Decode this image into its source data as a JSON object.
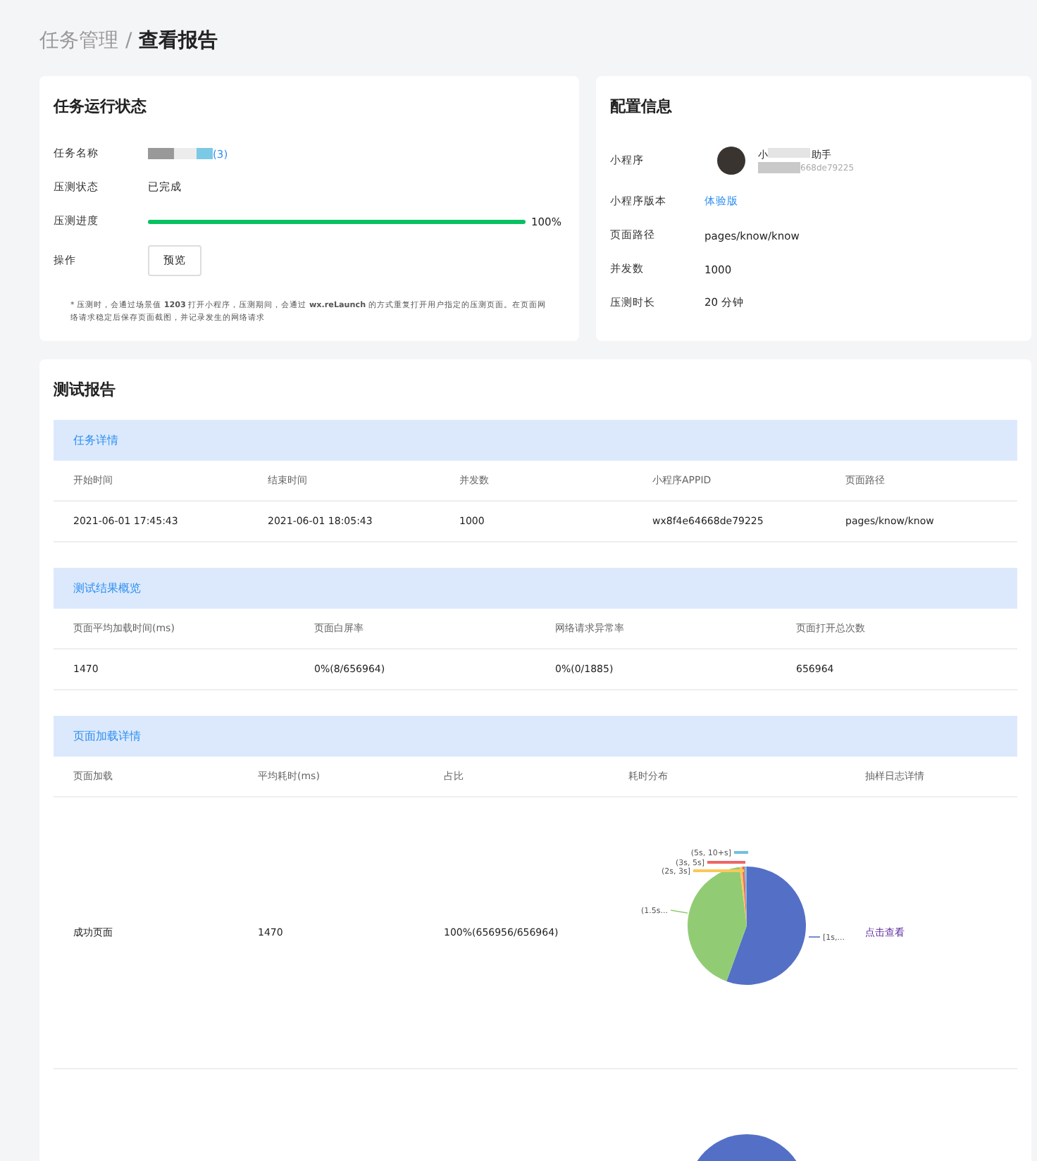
{
  "breadcrumb": {
    "parent": "任务管理",
    "separator": "/",
    "current": "查看报告"
  },
  "status_card": {
    "title": "任务运行状态",
    "rows": [
      {
        "kind": "redacted",
        "label": "任务名称",
        "value": "(3)"
      },
      {
        "kind": "text",
        "label": "压测状态",
        "value": "已完成"
      },
      {
        "kind": "progress",
        "label": "压测进度",
        "level": 1,
        "value": "100%"
      },
      {
        "kind": "button",
        "label": "操作",
        "value": "预览"
      }
    ],
    "note": "* 压测时，会通过场景值 **1203** 打开小程序，压测期间，会通过 **wx.reLaunch** 的方式重复打开用户指定的压测页面。在页面网络请求稳定后保存页面截图，并记录发生的网络请求"
  },
  "config_card": {
    "title": "配置信息",
    "rows": [
      {
        "kind": "app",
        "label": "小程序",
        "name_start": "小",
        "name_end": "助手",
        "appid_end": "668de79225"
      },
      {
        "kind": "link",
        "label": "小程序版本",
        "value": "体验版"
      },
      {
        "kind": "text",
        "label": "页面路径",
        "value": "pages/know/know"
      },
      {
        "kind": "text",
        "label": "并发数",
        "value": "1000"
      },
      {
        "kind": "text",
        "label": "压测时长",
        "value": "20 分钟"
      }
    ]
  },
  "report": {
    "title": "测试报告",
    "task_details": {
      "title": "任务详情",
      "columns": [
        "开始时间",
        "结束时间",
        "并发数",
        "小程序APPID",
        "页面路径"
      ],
      "rows": [
        [
          "2021-06-01 17:45:43",
          "2021-06-01 18:05:43",
          "1000",
          "wx8f4e64668de79225",
          "pages/know/know"
        ]
      ]
    },
    "overview": {
      "title": "测试结果概览",
      "columns": [
        "页面平均加载时间(ms)",
        "页面白屏率",
        "网络请求异常率",
        "页面打开总次数"
      ],
      "rows": [
        [
          "1470",
          "0%(8/656964)",
          "0%(0/1885)",
          "656964"
        ]
      ]
    },
    "page_load": {
      "title": "页面加载详情",
      "columns": [
        "页面加载",
        "平均耗时(ms)",
        "占比",
        "耗时分布",
        "抽样日志详情"
      ],
      "rows": [
        {
          "page": "成功页面",
          "avg": "1470",
          "ratio": "100%(656956/656964)",
          "link": "点击查看",
          "slices": [
            {
              "label": "[1s,...",
              "color": "#5470c6"
            },
            {
              "label": "(1.5s...",
              "color": "#91cc75"
            },
            {
              "label": "(2s, 3s]",
              "color": "#fac858"
            },
            {
              "label": "(3s, 5s]",
              "color": "#ee6666"
            },
            {
              "label": "(5s, 10+s]",
              "color": "#73c0de"
            }
          ]
        }
      ]
    }
  }
}
